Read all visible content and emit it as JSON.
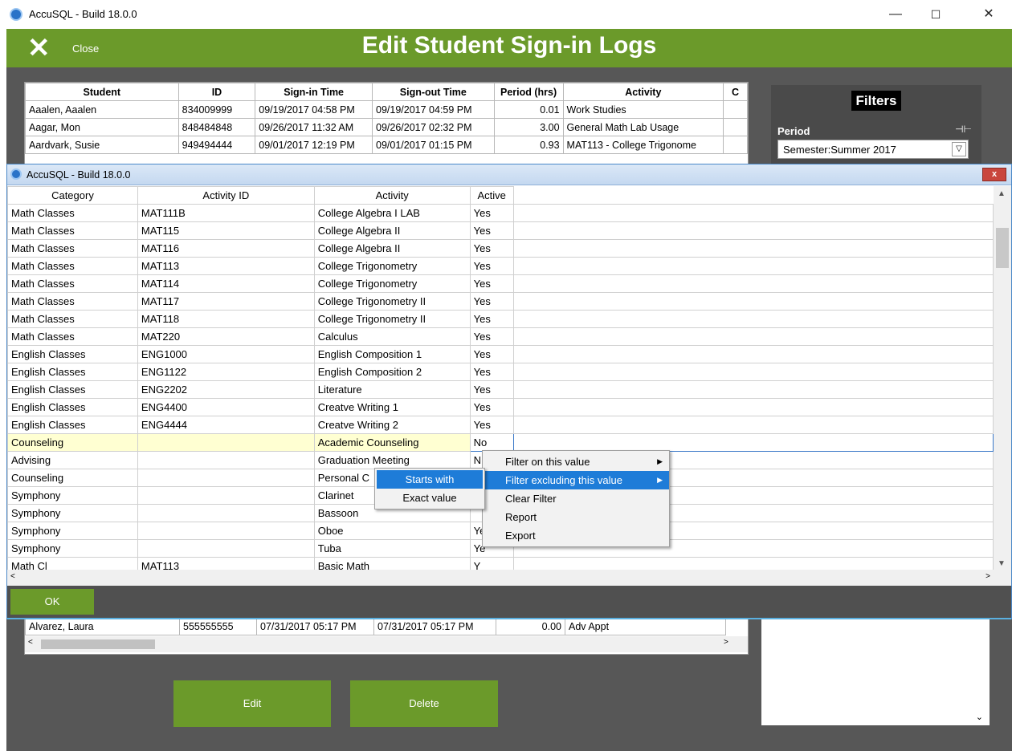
{
  "window": {
    "title": "AccuSQL - Build 18.0.0"
  },
  "header": {
    "close_label": "Close",
    "title": "Edit Student Sign-in Logs"
  },
  "bg_table": {
    "columns": [
      "Student",
      "ID",
      "Sign-in Time",
      "Sign-out Time",
      "Period (hrs)",
      "Activity",
      "C"
    ],
    "rows": [
      [
        "Aaalen, Aaalen",
        "834009999",
        "09/19/2017 04:58 PM",
        "09/19/2017 04:59 PM",
        "0.01",
        "Work Studies",
        ""
      ],
      [
        "Aagar, Mon",
        "848484848",
        "09/26/2017 11:32 AM",
        "09/26/2017 02:32 PM",
        "3.00",
        "General Math Lab Usage",
        ""
      ],
      [
        "Aardvark, Susie",
        "949494444",
        "09/01/2017 12:19 PM",
        "09/01/2017 01:15 PM",
        "0.93",
        "MAT113 - College Trigonome",
        ""
      ]
    ],
    "bottom_row": [
      "Alvarez, Laura",
      "555555555",
      "07/31/2017 05:17 PM",
      "07/31/2017 05:17 PM",
      "0.00",
      "Adv Appt"
    ]
  },
  "filters": {
    "title": "Filters",
    "period_label": "Period",
    "period_value": "Semester:Summer 2017"
  },
  "buttons": {
    "edit": "Edit",
    "delete": "Delete"
  },
  "dialog": {
    "title": "AccuSQL - Build 18.0.0",
    "close_label": "x",
    "ok_label": "OK",
    "columns": [
      "Category",
      "Activity ID",
      "Activity",
      "Active"
    ],
    "rows": [
      [
        "Math Classes",
        "MAT111B",
        "College Algebra I LAB",
        "Yes"
      ],
      [
        "Math Classes",
        "MAT115",
        "College Algebra II",
        "Yes"
      ],
      [
        "Math Classes",
        "MAT116",
        "College Algebra II",
        "Yes"
      ],
      [
        "Math Classes",
        "MAT113",
        "College Trigonometry",
        "Yes"
      ],
      [
        "Math Classes",
        "MAT114",
        "College Trigonometry",
        "Yes"
      ],
      [
        "Math Classes",
        "MAT117",
        "College Trigonometry II",
        "Yes"
      ],
      [
        "Math Classes",
        "MAT118",
        "College Trigonometry II",
        "Yes"
      ],
      [
        "Math Classes",
        "MAT220",
        "Calculus",
        "Yes"
      ],
      [
        "English Classes",
        "ENG1000",
        "English Composition 1",
        "Yes"
      ],
      [
        "English Classes",
        "ENG1122",
        "English Composition 2",
        "Yes"
      ],
      [
        "English Classes",
        "ENG2202",
        "Literature",
        "Yes"
      ],
      [
        "English Classes",
        "ENG4400",
        "Creatve Writing 1",
        "Yes"
      ],
      [
        "English Classes",
        "ENG4444",
        "Creatve Writing 2",
        "Yes"
      ],
      [
        "Counseling",
        "",
        "Academic Counseling",
        "No"
      ],
      [
        "Advising",
        "",
        "Graduation Meeting",
        "N"
      ],
      [
        "Counseling",
        "",
        "Personal C",
        ""
      ],
      [
        "Symphony",
        "",
        "Clarinet",
        ""
      ],
      [
        "Symphony",
        "",
        "Bassoon",
        ""
      ],
      [
        "Symphony",
        "",
        "Oboe",
        "Ye"
      ],
      [
        "Symphony",
        "",
        "Tuba",
        "Ye"
      ],
      [
        "Math Cl",
        "MAT113",
        "Basic Math",
        "Y"
      ]
    ],
    "selected_row": 13
  },
  "context_menu": {
    "items": [
      {
        "label": "Filter on this value",
        "has_submenu": true
      },
      {
        "label": "Filter excluding this value",
        "has_submenu": true
      },
      {
        "label": "Clear Filter",
        "has_submenu": false
      },
      {
        "label": "Report",
        "has_submenu": false
      },
      {
        "label": "Export",
        "has_submenu": false
      }
    ],
    "highlighted": 1
  },
  "submenu": {
    "items": [
      "Starts with",
      "Exact value"
    ],
    "highlighted": 0
  },
  "icons": {
    "close": "close-x-icon",
    "minimize": "minimize-icon",
    "maximize": "maximize-icon",
    "window_close": "window-close-icon",
    "app": "accusql-app-icon",
    "pin": "pin-icon",
    "dropdown": "chevron-down-icon",
    "submenu_arrow": "triangle-right-icon"
  },
  "colors": {
    "accent_green": "#6b9a2a",
    "menu_highlight": "#1e7cd8",
    "selected_row": "#ffffd2"
  }
}
